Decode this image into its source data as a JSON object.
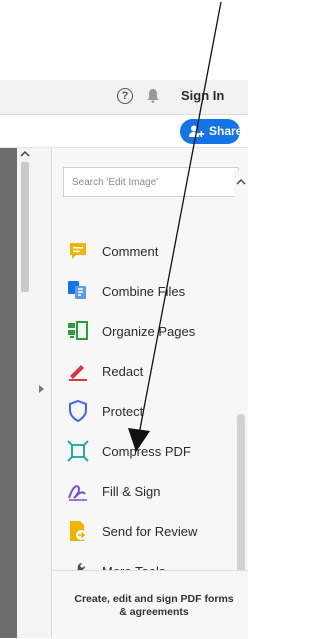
{
  "topbar": {
    "help_glyph": "?",
    "sign_in": "Sign In"
  },
  "share": {
    "label": "Share"
  },
  "search": {
    "placeholder": "Search 'Edit Image'"
  },
  "tools": [
    {
      "label": "Comment",
      "icon": "comment-icon",
      "color": "#f0b400"
    },
    {
      "label": "Combine Files",
      "icon": "combine-files-icon",
      "color": "#1473e6"
    },
    {
      "label": "Organize Pages",
      "icon": "organize-pages-icon",
      "color": "#2d9d3a"
    },
    {
      "label": "Redact",
      "icon": "redact-icon",
      "color": "#d7373f"
    },
    {
      "label": "Protect",
      "icon": "protect-icon",
      "color": "#3b63fb"
    },
    {
      "label": "Compress PDF",
      "icon": "compress-pdf-icon",
      "color": "#14a1a1"
    },
    {
      "label": "Fill & Sign",
      "icon": "fill-sign-icon",
      "color": "#7b4fd6"
    },
    {
      "label": "Send for Review",
      "icon": "send-for-review-icon",
      "color": "#f0b400"
    },
    {
      "label": "More Tools",
      "icon": "more-tools-icon",
      "color": "#4b4b4b"
    }
  ],
  "footer": {
    "promo": "Create, edit and sign PDF forms & agreements"
  },
  "colors": {
    "accent": "#1473e6",
    "panel_bg": "#f7f7f7",
    "doc_strip": "#6d6d6d"
  }
}
